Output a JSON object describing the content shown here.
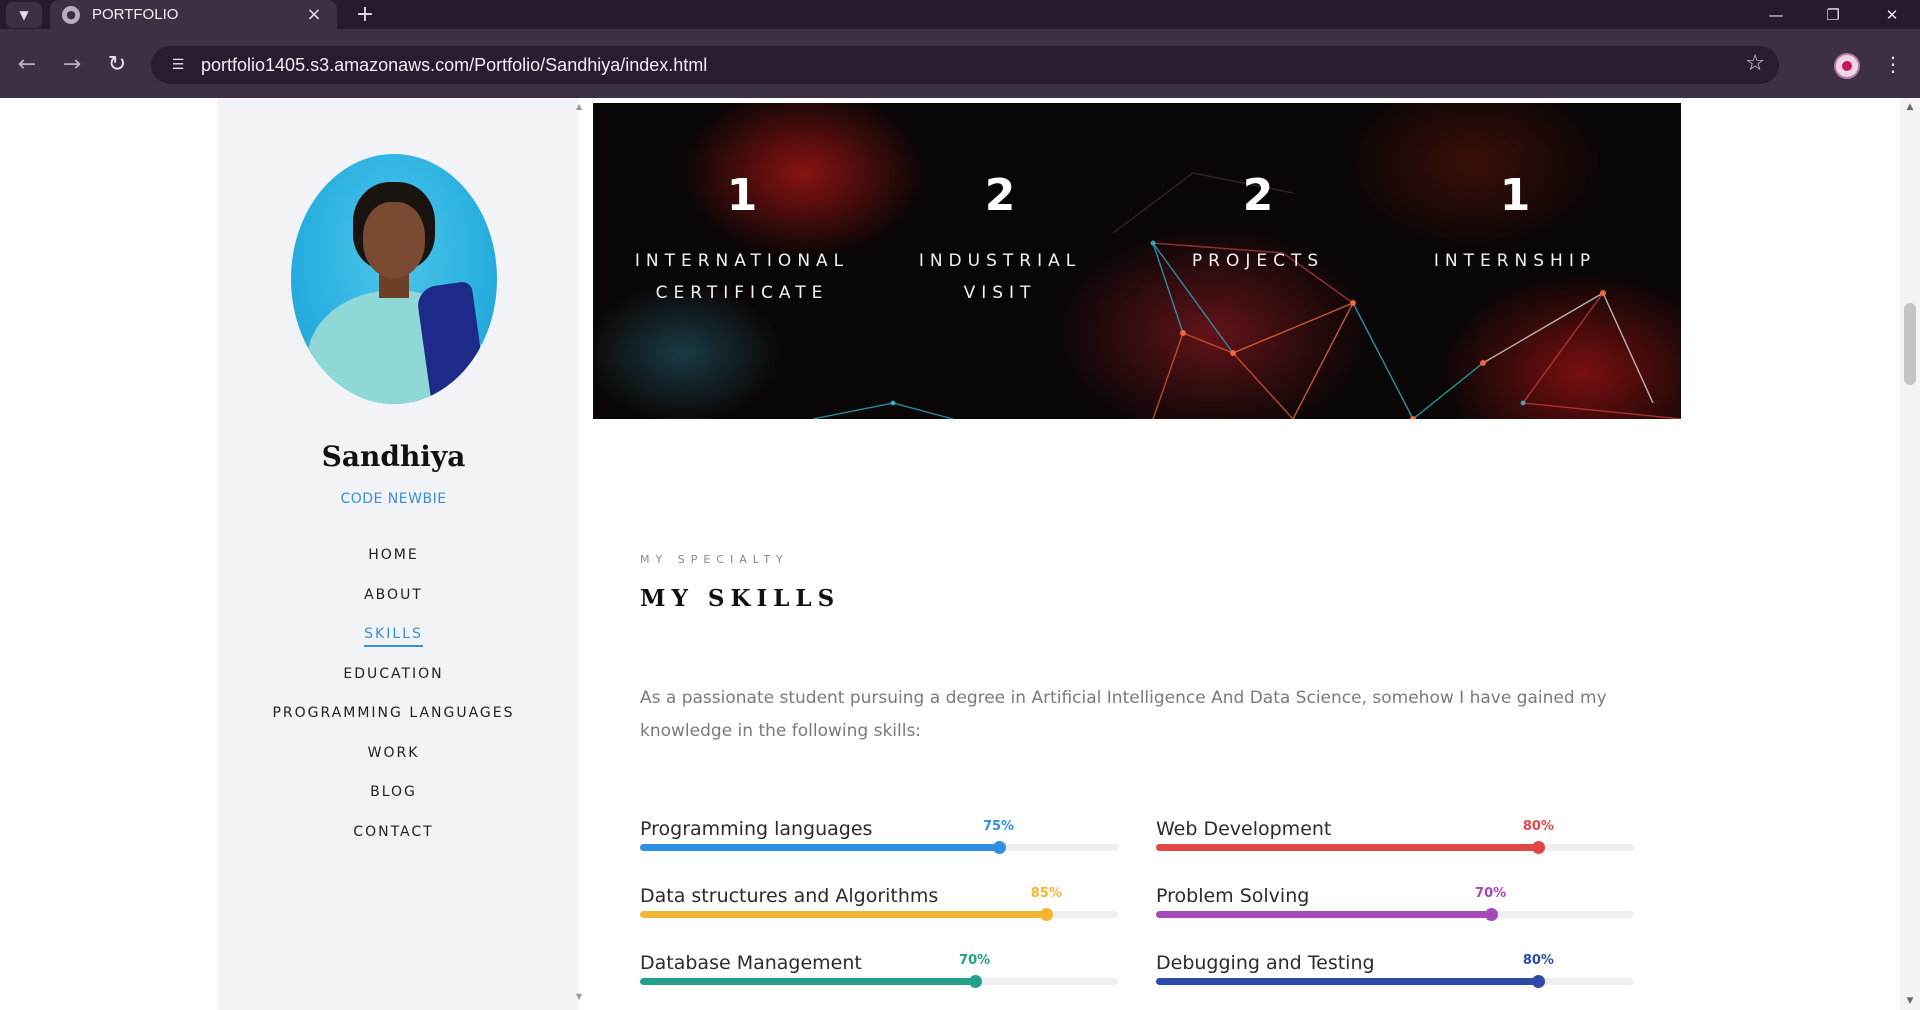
{
  "browser": {
    "tab_title": "PORTFOLIO",
    "url": "portfolio1405.s3.amazonaws.com/Portfolio/Sandhiya/index.html",
    "icons": [
      "chevron-down-icon",
      "globe-icon",
      "close-icon",
      "plus-icon",
      "minimize-icon",
      "restore-icon",
      "close-window-icon",
      "back-icon",
      "forward-icon",
      "reload-icon",
      "site-info-icon",
      "star-icon",
      "profile-avatar",
      "kebab-menu-icon"
    ]
  },
  "sidebar": {
    "name": "Sandhiya",
    "role": "CODE NEWBIE",
    "nav": [
      {
        "label": "HOME",
        "active": false
      },
      {
        "label": "ABOUT",
        "active": false
      },
      {
        "label": "SKILLS",
        "active": true
      },
      {
        "label": "EDUCATION",
        "active": false
      },
      {
        "label": "PROGRAMMING LANGUAGES",
        "active": false
      },
      {
        "label": "WORK",
        "active": false
      },
      {
        "label": "BLOG",
        "active": false
      },
      {
        "label": "CONTACT",
        "active": false
      }
    ]
  },
  "stats": [
    {
      "number": "1",
      "label_line1": "INTERNATIONAL",
      "label_line2": "CERTIFICATE"
    },
    {
      "number": "2",
      "label_line1": "INDUSTRIAL",
      "label_line2": "VISIT"
    },
    {
      "number": "2",
      "label_line1": "PROJECTS",
      "label_line2": ""
    },
    {
      "number": "1",
      "label_line1": "INTERNSHIP",
      "label_line2": ""
    }
  ],
  "skills_section": {
    "eyebrow": "MY SPECIALTY",
    "title": "MY SKILLS",
    "intro": "As a passionate student pursuing a degree in Artificial Intelligence And Data Science, somehow I have gained my knowledge in the following skills:",
    "skills": [
      {
        "name": "Programming languages",
        "percent": 75,
        "percent_label": "75%",
        "color": "#2f8fe0"
      },
      {
        "name": "Web Development",
        "percent": 80,
        "percent_label": "80%",
        "color": "#e04848"
      },
      {
        "name": "Data structures and Algorithms",
        "percent": 85,
        "percent_label": "85%",
        "color": "#f2b632"
      },
      {
        "name": "Problem Solving",
        "percent": 70,
        "percent_label": "70%",
        "color": "#a349b8"
      },
      {
        "name": "Database Management",
        "percent": 70,
        "percent_label": "70%",
        "color": "#22a08a"
      },
      {
        "name": "Debugging and Testing",
        "percent": 80,
        "percent_label": "80%",
        "color": "#2d4aa8"
      }
    ]
  }
}
